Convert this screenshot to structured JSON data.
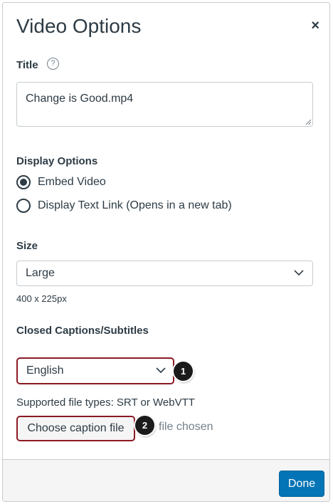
{
  "dialog": {
    "title": "Video Options",
    "close_glyph": "×"
  },
  "title_field": {
    "label": "Title",
    "help_glyph": "?",
    "value": "Change is Good.mp4"
  },
  "display_options": {
    "label": "Display Options",
    "options": [
      {
        "label": "Embed Video",
        "checked": true
      },
      {
        "label": "Display Text Link (Opens in a new tab)",
        "checked": false
      }
    ]
  },
  "size": {
    "label": "Size",
    "selected": "Large",
    "dimensions": "400 x 225px"
  },
  "captions": {
    "label": "Closed Captions/Subtitles",
    "language_selected": "English",
    "supported_types": "Supported file types: SRT or WebVTT",
    "choose_button": "Choose caption file",
    "file_status": "file chosen"
  },
  "callouts": [
    "1",
    "2"
  ],
  "footer": {
    "done_label": "Done"
  },
  "colors": {
    "accent": "#0374b5",
    "highlight": "#8b1a24",
    "text": "#2d3b45"
  }
}
